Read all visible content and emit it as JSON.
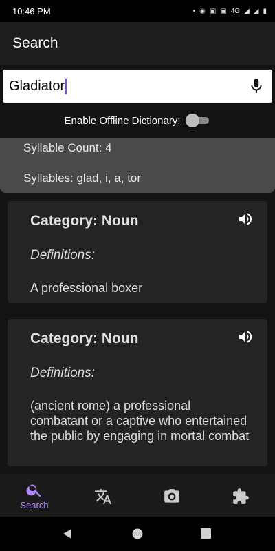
{
  "status_bar": {
    "time": "10:46 PM",
    "network": "4G"
  },
  "app_bar": {
    "title": "Search"
  },
  "search": {
    "value": "Gladiator"
  },
  "offline": {
    "label": "Enable Offline Dictionary:",
    "enabled": false
  },
  "syllables": {
    "count_text": "Syllable Count: 4",
    "list_text": "Syllables: glad, i, a, tor"
  },
  "cards": [
    {
      "category": "Category: Noun",
      "definitions_label": "Definitions:",
      "definition": "A professional boxer"
    },
    {
      "category": "Category: Noun",
      "definitions_label": "Definitions:",
      "definition": "(ancient rome) a professional combatant or a captive who entertained the public by engaging in mortal combat"
    }
  ],
  "bottom_nav": [
    {
      "label": "Search",
      "icon": "search-icon",
      "active": true
    },
    {
      "label": "",
      "icon": "translate-icon",
      "active": false
    },
    {
      "label": "",
      "icon": "camera-icon",
      "active": false
    },
    {
      "label": "",
      "icon": "extension-icon",
      "active": false
    }
  ],
  "colors": {
    "accent": "#b388ff",
    "background": "#141414",
    "card": "#242424",
    "panel": "#4a4a4a"
  }
}
